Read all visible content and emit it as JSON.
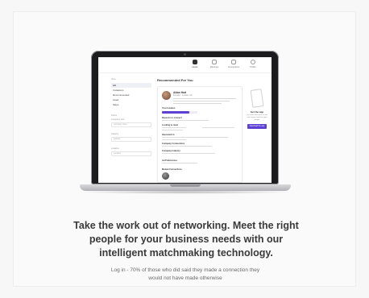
{
  "screen": {
    "nav": [
      {
        "label": "Home",
        "active": true
      },
      {
        "label": "Meetings",
        "active": false
      },
      {
        "label": "Connections",
        "active": false
      },
      {
        "label": "Profile",
        "active": false
      }
    ],
    "sidebar": {
      "heading": "View",
      "items": [
        "All",
        "Invitations",
        "Recommended",
        "Liked",
        "Skips"
      ],
      "filters_heading": "Filters",
      "filters": [
        {
          "label": "Company size",
          "placeholder": "Company name"
        },
        {
          "label": "Industry",
          "placeholder": "Industry"
        },
        {
          "label": "Location",
          "placeholder": "Location"
        }
      ]
    },
    "title": "Recommended For You",
    "profile": {
      "name": "Aidan Hart",
      "role": "Founder · London, UK",
      "sections": [
        "Your location",
        "Reasons to connect",
        "Looking to meet",
        "Interested in",
        "Company Connections",
        "Company Industry",
        "Ad Preferences",
        "Mutual Connections"
      ]
    },
    "aside": {
      "title": "Get the app",
      "text": "It's easier than ever to find and connect with the right people",
      "button": "Download the app"
    },
    "accent": "#5d3fd3"
  },
  "headline": "Take the work out of networking. Meet the right people for your business needs with our intelligent matchmaking technology.",
  "caption": "Log in - 70% of those who did said they made a connection they would not have made otherwise"
}
